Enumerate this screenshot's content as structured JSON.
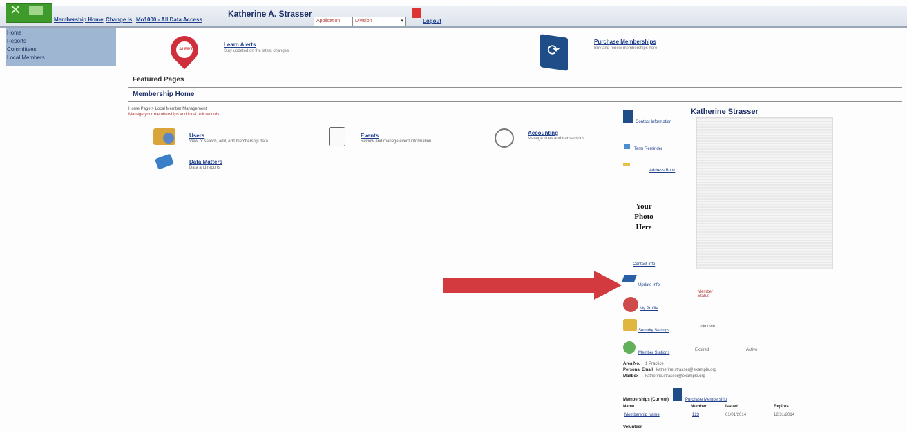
{
  "header": {
    "links": [
      {
        "label": "Membership Home"
      },
      {
        "label": "Change Is"
      },
      {
        "label": "Mo1000 - All Data Access"
      }
    ],
    "user_name": "Katherine A. Strasser",
    "select_role": "Application",
    "select_org": "Division",
    "logout_label": "Logout"
  },
  "sidemenu": {
    "items": [
      "Home",
      "Reports",
      "Committees",
      "Local Members"
    ]
  },
  "featured": [
    {
      "title": "Learn Alerts",
      "desc": "Stay updated on the latest changes",
      "icon": "map-pin-icon",
      "pin_text": "ALERT"
    },
    {
      "title": "Purchase Memberships",
      "desc": "Buy and renew memberships here",
      "icon": "sync-icon"
    }
  ],
  "featured_pages_label": "Featured Pages",
  "membership_home_label": "Membership Home",
  "breadcrumb": "Home Page > Local Member Management",
  "notice": "Manage your memberships and local unit records",
  "quick_links": [
    {
      "title": "Users",
      "desc": "View or search, add, edit membership data",
      "icon": "users-icon"
    },
    {
      "title": "Events",
      "desc": "Review and manage event information",
      "icon": "events-icon"
    },
    {
      "title": "Accounting",
      "desc": "Manage dues and transactions",
      "icon": "accounting-icon"
    },
    {
      "title": "Data Matters",
      "desc": "Data and reports",
      "icon": "data-matters-icon"
    }
  ],
  "profile": {
    "name": "Katherine Strasser",
    "photo_text": "Your Photo Here",
    "top_links": [
      "Contact Information",
      "Term Reminder",
      "Address Book"
    ],
    "links": [
      {
        "label": "Contact Info",
        "icon": "contact-icon"
      },
      {
        "label": "Update Info",
        "icon": "update-icon",
        "note": "Member Status"
      },
      {
        "label": "My Profile",
        "icon": "profile-icon"
      },
      {
        "label": "Security Settings",
        "icon": "security-icon",
        "note": "Unknown"
      },
      {
        "label": "Member Stations",
        "icon": "stations-icon",
        "note": "Expired",
        "note2": "Active"
      }
    ],
    "details": [
      {
        "label": "Area No.",
        "value": "1 Practice"
      },
      {
        "label": "Personal Email",
        "value": "katherine.strasser@example.org"
      },
      {
        "label": "Mailbox",
        "value": "katherine.strasser@example.org"
      }
    ],
    "membership_label": "Memberships (Current)",
    "membership_link": "Purchase Membership",
    "membership_cols": [
      "Name",
      "Number",
      "Issued",
      "Expires"
    ],
    "membership_row": {
      "name": "Membership Name",
      "number": "123",
      "issued": "01/01/2014",
      "expires": "12/31/2014"
    },
    "footer_label": "Volunteer"
  },
  "colors": {
    "arrow": "#d23a3f",
    "brand_green": "#3e9b2b",
    "nav_blue": "#1f3f8c"
  }
}
